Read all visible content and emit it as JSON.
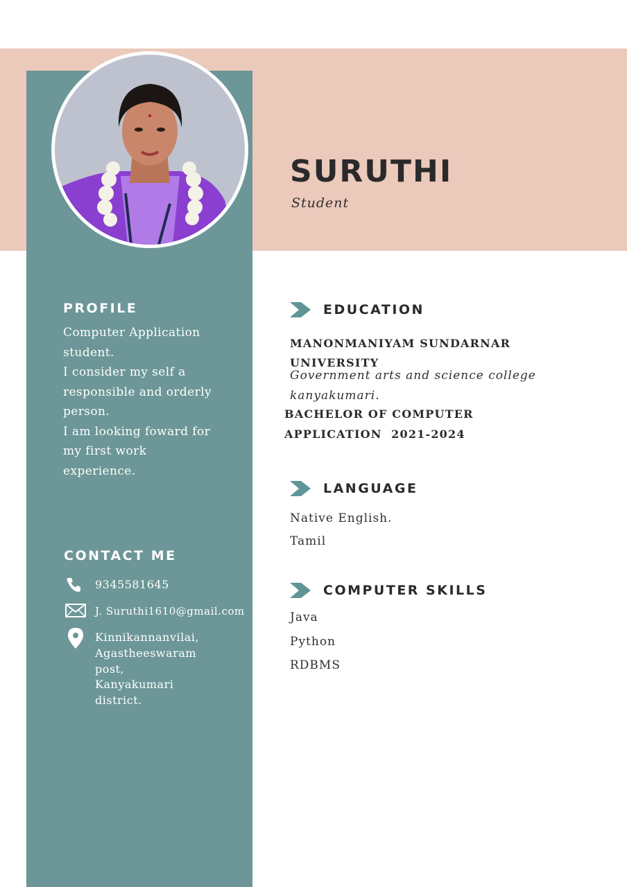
{
  "header": {
    "name": "SURUTHI",
    "role": "Student"
  },
  "profile": {
    "title": "PROFILE",
    "lines": [
      "Computer Application",
      "student.",
      "I consider my self a",
      "responsible and orderly",
      "person.",
      "I am looking foward for",
      "my first work",
      "experience."
    ]
  },
  "contact": {
    "title": "CONTACT ME",
    "phone": "9345581645",
    "email": "J. Suruthi1610@gmail.com",
    "address_lines": [
      "Kinnikannanvilai,",
      "Agastheeswaram",
      "post,",
      "Kanyakumari",
      "district."
    ],
    "icons": [
      "phone-icon",
      "mail-icon",
      "location-pin-icon"
    ]
  },
  "education": {
    "title": "EDUCATION",
    "university_line1": "MANONMANIYAM SUNDARNAR",
    "university_line2": "UNIVERSITY",
    "college_line1": "Government arts and science college",
    "college_line2": "kanyakumari.",
    "degree_line1": "BACHELOR OF COMPUTER",
    "degree_line2": "APPLICATION  2021-2024"
  },
  "language": {
    "title": "LANGUAGE",
    "items": [
      "Native English.",
      "Tamil"
    ]
  },
  "skills": {
    "title": "COMPUTER SKILLS",
    "items": [
      "Java",
      "Python",
      "RDBMS"
    ]
  },
  "colors": {
    "sidebar": "#6c9697",
    "header_band": "#ebc9bb",
    "accent_chevron": "#5f9596",
    "text_dark": "#2a2a2a"
  }
}
